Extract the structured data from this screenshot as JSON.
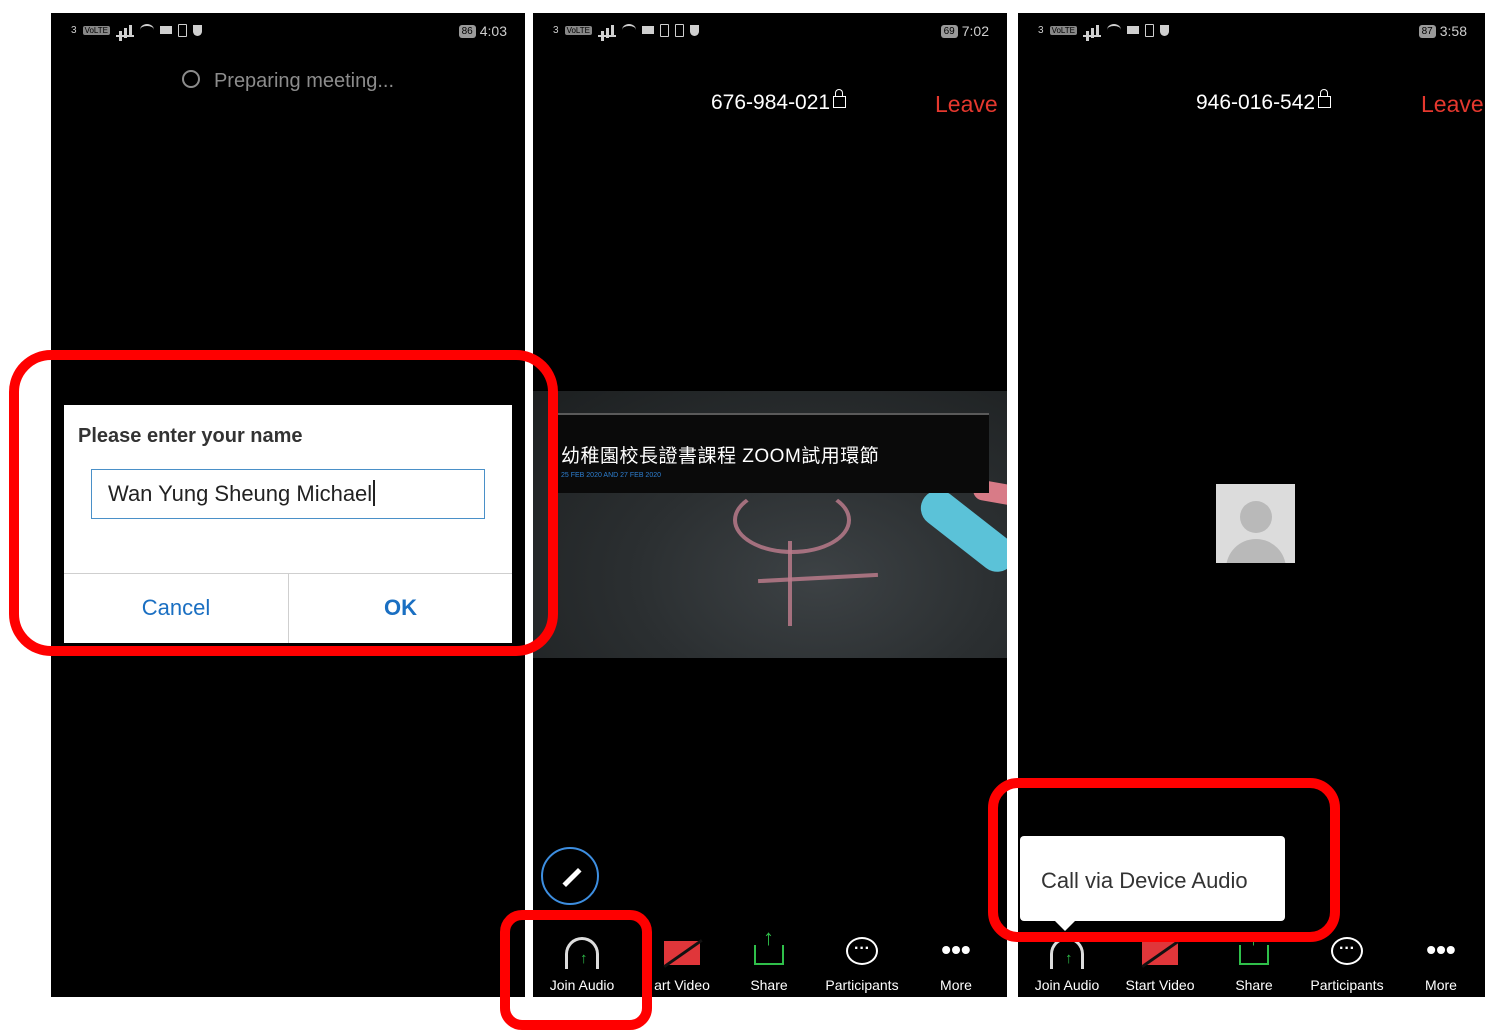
{
  "screen1": {
    "status": {
      "network": "3",
      "battery": "86",
      "time": "4:03"
    },
    "preparing_text": "Preparing meeting...",
    "dialog": {
      "title": "Please enter your name",
      "name_value": "Wan Yung Sheung Michael",
      "cancel_label": "Cancel",
      "ok_label": "OK"
    }
  },
  "screen2": {
    "status": {
      "network": "3",
      "battery": "69",
      "time": "7:02"
    },
    "meeting_id": "676-984-021",
    "leave_label": "Leave",
    "shared_content": {
      "title": "幼稚園校長證書課程 ZOOM試用環節",
      "date": "25 FEB 2020 AND 27 FEB 2020"
    },
    "toolbar": [
      "Join Audio",
      "art Video",
      "Share",
      "Participants",
      "More"
    ]
  },
  "screen3": {
    "status": {
      "network": "3",
      "battery": "87",
      "time": "3:58"
    },
    "meeting_id": "946-016-542",
    "leave_label": "Leave",
    "tooltip": "Call via Device Audio",
    "toolbar": [
      "Join Audio",
      "Start Video",
      "Share",
      "Participants",
      "More"
    ]
  },
  "colors": {
    "highlight": "#ff0000",
    "leave": "#e5382e",
    "accent_blue": "#1a6fc2",
    "green": "#2fbf4a"
  }
}
